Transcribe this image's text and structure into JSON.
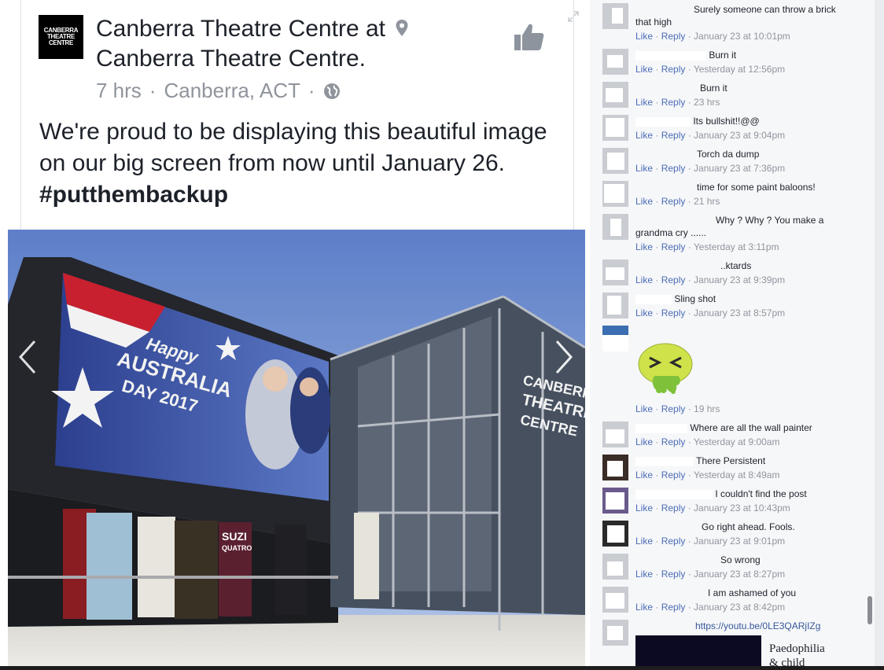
{
  "post": {
    "logo_lines": [
      "CANBERRA",
      "THEATRE",
      "CENTRE"
    ],
    "page_name": "Canberra Theatre Centre",
    "at_word": "at",
    "location_name": "Canberra Theatre Centre.",
    "time": "7 hrs",
    "place": "Canberra, ACT",
    "text": "We're proud to be displaying this beautiful image on our big screen from now until January 26.",
    "hashtag": "#putthembackup",
    "photo": {
      "screen_lines": [
        "Happy",
        "AUSTRALIA",
        "DAY 2017"
      ],
      "building_lines": [
        "CANBERRA",
        "THEATRE",
        "CENTRE"
      ],
      "poster_lines": [
        "SUZI",
        "QUATRO"
      ]
    }
  },
  "comments": [
    {
      "text": "Surely someone can throw a brick",
      "text2": "that high",
      "like": "Like",
      "reply": "Reply",
      "time": "January 23 at 10:01pm"
    },
    {
      "text": "Burn it",
      "like": "Like",
      "reply": "Reply",
      "time": "Yesterday at 12:56pm"
    },
    {
      "text": "Burn it",
      "like": "Like",
      "reply": "Reply",
      "time": "23 hrs"
    },
    {
      "text": "Its bullshit!!@@",
      "like": "Like",
      "reply": "Reply",
      "time": "January 23 at 9:04pm"
    },
    {
      "text": "Torch da dump",
      "like": "Like",
      "reply": "Reply",
      "time": "January 23 at 7:36pm"
    },
    {
      "text": "time for some paint baloons!",
      "like": "Like",
      "reply": "Reply",
      "time": "21 hrs"
    },
    {
      "text": "Why ? Why ? You make a",
      "text2": "grandma cry ......",
      "like": "Like",
      "reply": "Reply",
      "time": "Yesterday at 3:11pm"
    },
    {
      "text": "..ktards",
      "like": "Like",
      "reply": "Reply",
      "time": "January 23 at 9:39pm"
    },
    {
      "text": "Sling shot",
      "like": "Like",
      "reply": "Reply",
      "time": "January 23 at 8:57pm"
    },
    {
      "text": "",
      "like": "Like",
      "reply": "Reply",
      "time": "19 hrs"
    },
    {
      "text": "Where are all the wall painter",
      "like": "Like",
      "reply": "Reply",
      "time": "Yesterday at 9:00am"
    },
    {
      "text": "There Persistent",
      "like": "Like",
      "reply": "Reply",
      "time": "Yesterday at 8:49am"
    },
    {
      "text": "I couldn't find the post",
      "like": "Like",
      "reply": "Reply",
      "time": "January 23 at 10:43pm"
    },
    {
      "text": "Go right ahead. Fools.",
      "like": "Like",
      "reply": "Reply",
      "time": "January 23 at 9:01pm"
    },
    {
      "text": "So wrong",
      "like": "Like",
      "reply": "Reply",
      "time": "January 23 at 8:27pm"
    },
    {
      "text": "I am ashamed of you",
      "like": "Like",
      "reply": "Reply",
      "time": "January 23 at 8:42pm"
    }
  ],
  "last_comment": {
    "link": "https://youtu.be/0LE3QARjIZg",
    "video_title_1": "Paedophilia",
    "video_title_2": "& child"
  },
  "icons": {
    "like": "thumbs-up-icon",
    "location": "location-pin-icon",
    "privacy": "globe-icon",
    "prev": "chevron-left-icon",
    "next": "chevron-right-icon",
    "expand": "expand-icon",
    "sticker": "sick-face-sticker"
  },
  "colors": {
    "link_blue": "#4b6cb7",
    "meta_gray": "#90949c",
    "text": "#1d2129"
  }
}
